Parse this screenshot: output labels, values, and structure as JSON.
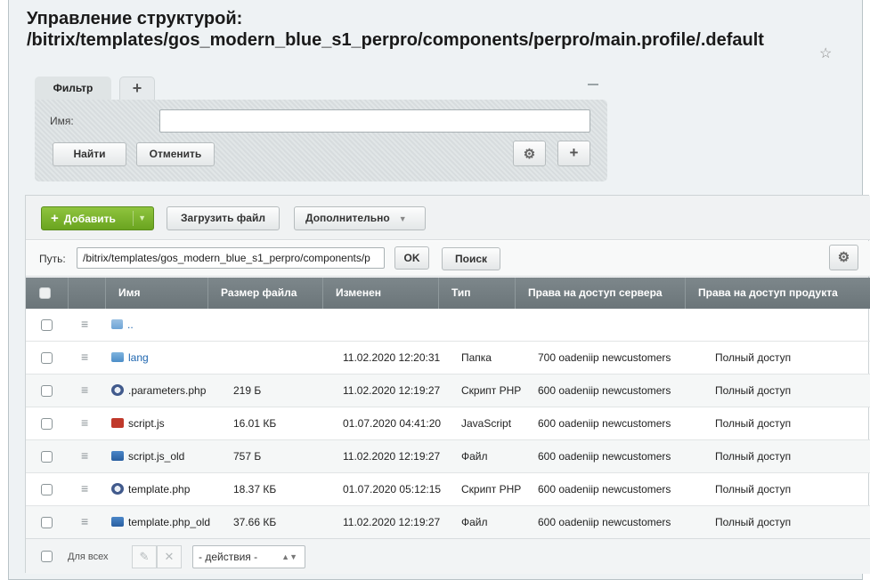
{
  "page": {
    "title_line1": "Управление структурой:",
    "title_line2": "/bitrix/templates/gos_modern_blue_s1_perpro/components/perpro/main.profile/.default",
    "favorite_icon": "star-icon"
  },
  "filter": {
    "tab_label": "Фильтр",
    "add_tab_label": "+",
    "name_label": "Имя:",
    "name_value": "",
    "find_label": "Найти",
    "cancel_label": "Отменить",
    "settings_icon": "gear-icon",
    "add_icon_label": "+"
  },
  "toolbar": {
    "add_label": "Добавить",
    "upload_label": "Загрузить файл",
    "more_label": "Дополнительно"
  },
  "pathbar": {
    "label": "Путь:",
    "value": "/bitrix/templates/gos_modern_blue_s1_perpro/components/p",
    "ok_label": "OK",
    "search_label": "Поиск"
  },
  "table": {
    "columns": [
      "Имя",
      "Размер файла",
      "Изменен",
      "Тип",
      "Права на доступ сервера",
      "Права на доступ продукта"
    ],
    "up_row": {
      "name": ".."
    },
    "rows": [
      {
        "icon": "folder",
        "name": "lang",
        "size": "",
        "modified": "11.02.2020 12:20:31",
        "type": "Папка",
        "server_rights": "700 oadeniip newcustomers",
        "product_rights": "Полный доступ"
      },
      {
        "icon": "php",
        "name": ".parameters.php",
        "size": "219 Б",
        "modified": "11.02.2020 12:19:27",
        "type": "Скрипт PHP",
        "server_rights": "600 oadeniip newcustomers",
        "product_rights": "Полный доступ"
      },
      {
        "icon": "js",
        "name": "script.js",
        "size": "16.01 КБ",
        "modified": "01.07.2020 04:41:20",
        "type": "JavaScript",
        "server_rights": "600 oadeniip newcustomers",
        "product_rights": "Полный доступ"
      },
      {
        "icon": "file",
        "name": "script.js_old",
        "size": "757 Б",
        "modified": "11.02.2020 12:19:27",
        "type": "Файл",
        "server_rights": "600 oadeniip newcustomers",
        "product_rights": "Полный доступ"
      },
      {
        "icon": "php",
        "name": "template.php",
        "size": "18.37 КБ",
        "modified": "01.07.2020 05:12:15",
        "type": "Скрипт PHP",
        "server_rights": "600 oadeniip newcustomers",
        "product_rights": "Полный доступ"
      },
      {
        "icon": "file",
        "name": "template.php_old",
        "size": "37.66 КБ",
        "modified": "11.02.2020 12:19:27",
        "type": "Файл",
        "server_rights": "600 oadeniip newcustomers",
        "product_rights": "Полный доступ"
      }
    ]
  },
  "footer": {
    "all_label": "Для всех",
    "actions_value": "- действия -"
  },
  "colors": {
    "add_button": "#6aa420",
    "header_bg": "#737d81",
    "link": "#2067b0"
  }
}
